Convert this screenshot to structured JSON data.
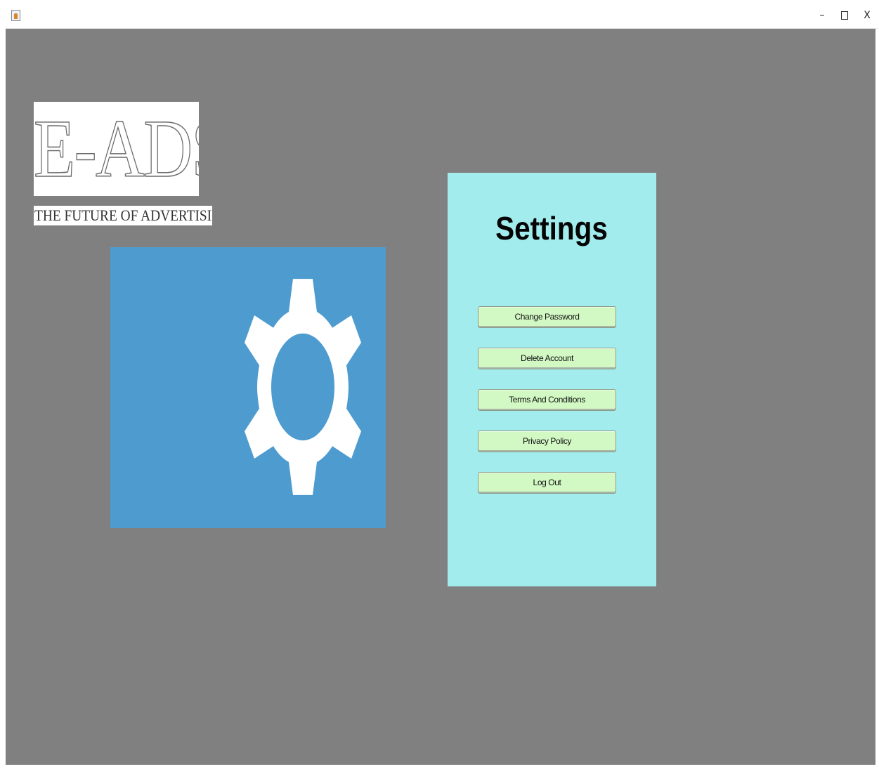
{
  "window": {
    "title": "",
    "app_icon": "java-cup-icon",
    "controls": {
      "minimize": "–",
      "maximize": "",
      "close": "X"
    }
  },
  "logo": {
    "brand": "E-ADS",
    "tagline": "THE FUTURE OF ADVERTISING"
  },
  "settings": {
    "title": "Settings",
    "buttons": {
      "change_password": "Change Password",
      "delete_account": "Delete Account",
      "terms": "Terms And Conditions",
      "privacy": "Privacy Policy",
      "logout": "Log Out"
    }
  },
  "colors": {
    "content_background": "#808080",
    "gear_panel": "#4e9ccf",
    "settings_panel": "#a2ecee",
    "button": "#d2f9c4"
  },
  "icons": {
    "settings_illustration": "gear-icon"
  }
}
